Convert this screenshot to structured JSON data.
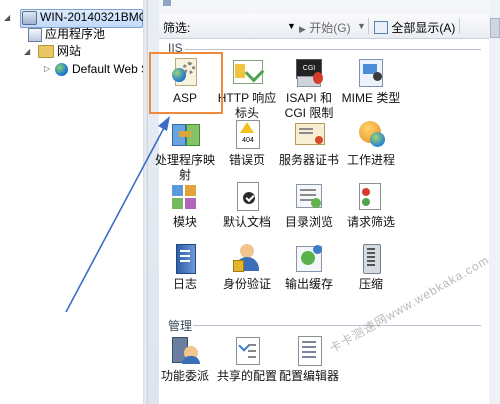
{
  "tree": {
    "server": "WIN-20140321BMQ",
    "app_pools": "应用程序池",
    "sites": "网站",
    "default_site": "Default Web S"
  },
  "filterbar": {
    "filter_label": "筛选:",
    "start_label": "开始(G)",
    "show_all_label": "全部显示(A)"
  },
  "groups": {
    "iis": "IIS",
    "management": "管理"
  },
  "iis_features": [
    {
      "label": "ASP",
      "icon": "asp-icon"
    },
    {
      "label": "HTTP 响应标头",
      "icon": "http-response-headers-icon"
    },
    {
      "label": "ISAPI 和 CGI 限制",
      "icon": "isapi-cgi-icon"
    },
    {
      "label": "MIME 类型",
      "icon": "mime-types-icon"
    },
    {
      "label": "处理程序映射",
      "icon": "handler-mappings-icon"
    },
    {
      "label": "错误页",
      "icon": "error-pages-icon"
    },
    {
      "label": "服务器证书",
      "icon": "server-certificates-icon"
    },
    {
      "label": "工作进程",
      "icon": "worker-processes-icon"
    },
    {
      "label": "模块",
      "icon": "modules-icon"
    },
    {
      "label": "默认文档",
      "icon": "default-document-icon"
    },
    {
      "label": "目录浏览",
      "icon": "directory-browsing-icon"
    },
    {
      "label": "请求筛选",
      "icon": "request-filtering-icon"
    },
    {
      "label": "日志",
      "icon": "logging-icon"
    },
    {
      "label": "身份验证",
      "icon": "authentication-icon"
    },
    {
      "label": "输出缓存",
      "icon": "output-caching-icon"
    },
    {
      "label": "压缩",
      "icon": "compression-icon"
    }
  ],
  "management_features": [
    {
      "label": "功能委派",
      "icon": "feature-delegation-icon"
    },
    {
      "label": "共享的配置",
      "icon": "shared-configuration-icon"
    },
    {
      "label": "配置编辑器",
      "icon": "configuration-editor-icon"
    }
  ],
  "watermark": "卡卡测速网www.webkaka.com",
  "colors": {
    "highlight_box": "#ee8a3c",
    "arrow": "#3c6cc8",
    "selection": "#c1dbfc"
  }
}
